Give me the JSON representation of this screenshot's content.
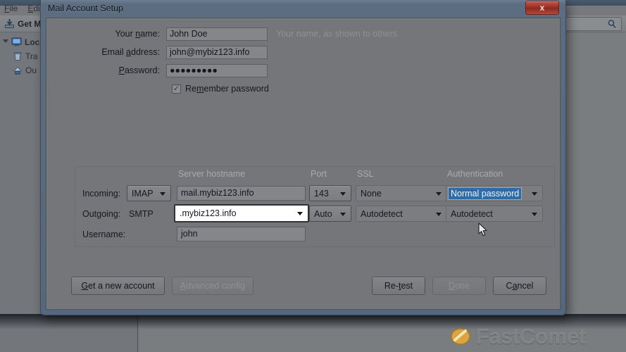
{
  "background": {
    "menus": [
      {
        "label": "File",
        "accel": "F"
      },
      {
        "label": "Edit",
        "accel": "E"
      }
    ],
    "toolbar": {
      "get_mail_label": "Get M",
      "get_mail_icon": "download-mail-icon"
    },
    "search": {
      "placeholder": "",
      "icon": "search-icon"
    },
    "folders": [
      {
        "label": "Loca",
        "icon": "local-folders-icon",
        "type": "account"
      },
      {
        "label": "Tra",
        "icon": "trash-icon",
        "type": "folder"
      },
      {
        "label": "Ou",
        "icon": "outbox-icon",
        "type": "folder"
      }
    ]
  },
  "watermark": {
    "text": "FastComet",
    "logo_icon": "comet-logo-icon"
  },
  "dialog": {
    "title": "Mail Account Setup",
    "close_label": "x",
    "form": {
      "rows": [
        {
          "label_pre": "Your ",
          "label_accel": "n",
          "label_post": "ame:",
          "value": "John Doe",
          "hint": "Your name, as shown to others",
          "type": "text"
        },
        {
          "label_pre": "Email ",
          "label_accel": "a",
          "label_post": "ddress:",
          "value": "john@mybiz123.info",
          "hint": "",
          "type": "text"
        },
        {
          "label_pre": "",
          "label_accel": "P",
          "label_post": "assword:",
          "value": "●●●●●●●●●",
          "hint": "",
          "type": "password"
        }
      ],
      "remember": {
        "label_pre": "Re",
        "label_accel": "m",
        "label_post": "ember password",
        "checked": true,
        "tick": "✓"
      }
    },
    "settings": {
      "headers": {
        "hostname": "Server hostname",
        "port": "Port",
        "ssl": "SSL",
        "auth": "Authentication"
      },
      "incoming": {
        "row_label": "Incoming:",
        "protocol": "IMAP",
        "hostname": "mail.mybiz123.info",
        "port": "143",
        "ssl": "None",
        "auth": "Normal password",
        "auth_selected": true
      },
      "outgoing": {
        "row_label": "Outgoing:",
        "protocol": "SMTP",
        "hostname": ".mybiz123.info",
        "hostname_focused": true,
        "port": "Auto",
        "ssl": "Autodetect",
        "auth": "Autodetect"
      },
      "username": {
        "row_label": "Username:",
        "value": "john"
      }
    },
    "buttons": {
      "get_new_account": {
        "pre": "",
        "accel": "G",
        "post": "et a new account",
        "disabled": false
      },
      "advanced_config": {
        "pre": "",
        "accel": "A",
        "post": "dvanced config",
        "disabled": true
      },
      "retest": {
        "pre": "Re-",
        "accel": "t",
        "post": "est",
        "disabled": false
      },
      "done": {
        "pre": "",
        "accel": "D",
        "post": "one",
        "disabled": true
      },
      "cancel": {
        "pre": "C",
        "accel": "a",
        "post": "ncel",
        "disabled": false
      }
    }
  },
  "colors": {
    "dialog_chrome": "#5c6d81",
    "panel": "#757679",
    "selection_blue": "#2d6ca6",
    "close_red": "#9e3226",
    "watermark_gold": "#d9a441"
  }
}
